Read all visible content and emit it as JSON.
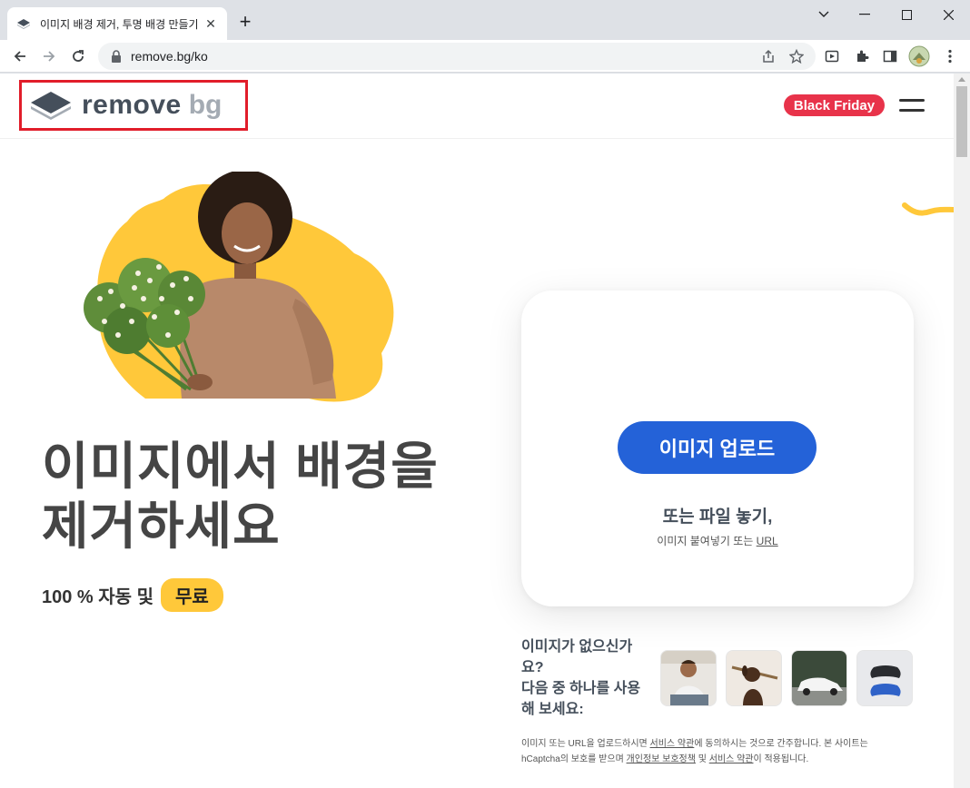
{
  "browser": {
    "tab_title": "이미지 배경 제거, 투명 배경 만들기",
    "url": "remove.bg/ko"
  },
  "header": {
    "logo_word1": "remove",
    "logo_word2": "bg",
    "black_friday": "Black Friday"
  },
  "hero": {
    "headline_line1": "이미지에서 배경을",
    "headline_line2": "제거하세요",
    "sub_prefix": "100 % 자동 및",
    "sub_free": "무료"
  },
  "upload": {
    "button": "이미지 업로드",
    "drop_text": "또는 파일 놓기,",
    "paste_prefix": "이미지 붙여넣기 또는",
    "paste_url": "URL"
  },
  "samples": {
    "prompt_line1": "이미지가 없으신가",
    "prompt_line2": "요?",
    "prompt_line3": "다음 중 하나를 사용",
    "prompt_line4": "해 보세요:",
    "thumbnails": [
      "man-sitting",
      "dog-with-stick",
      "white-car",
      "game-controllers"
    ]
  },
  "legal": {
    "t1": "이미지 또는 URL을 업로드하시면 ",
    "terms": "서비스 약관",
    "t2": "에 동의하시는 것으로 간주합니다. 본 사이트는",
    "t3": "hCaptcha의 보호를 받으며 ",
    "privacy": "개인정보 보호정책",
    "t4": " 및 ",
    "terms2": "서비스 약관",
    "t5": "이 적용됩니다."
  },
  "colors": {
    "accent_blue": "#2462d8",
    "badge_red": "#e8334a",
    "yellow": "#ffc83a",
    "logo_outline_red": "#e11d2a"
  }
}
